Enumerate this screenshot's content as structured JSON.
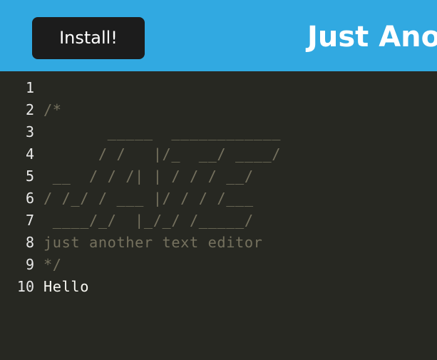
{
  "header": {
    "install_label": "Install!",
    "title": "Just Another Text Editor"
  },
  "colors": {
    "header_bg": "#31a9e1",
    "button_bg": "#1c1c1c",
    "editor_bg": "#272822",
    "comment": "#75715e",
    "text": "#f8f8f2"
  },
  "editor": {
    "lines": [
      {
        "num": "1",
        "text": "",
        "kind": "plain"
      },
      {
        "num": "2",
        "text": "/*",
        "kind": "comment"
      },
      {
        "num": "3",
        "text": "       _____  ____________",
        "kind": "comment"
      },
      {
        "num": "4",
        "text": "      / /   |/_  __/ ____/",
        "kind": "comment"
      },
      {
        "num": "5",
        "text": " __  / / /| | / / / __/",
        "kind": "comment"
      },
      {
        "num": "6",
        "text": "/ /_/ / ___ |/ / / /___",
        "kind": "comment"
      },
      {
        "num": "7",
        "text": " ____/_/  |_/_/ /_____/",
        "kind": "comment"
      },
      {
        "num": "8",
        "text": "just another text editor",
        "kind": "comment"
      },
      {
        "num": "9",
        "text": "*/",
        "kind": "comment"
      },
      {
        "num": "10",
        "text": "Hello",
        "kind": "plain"
      }
    ]
  }
}
